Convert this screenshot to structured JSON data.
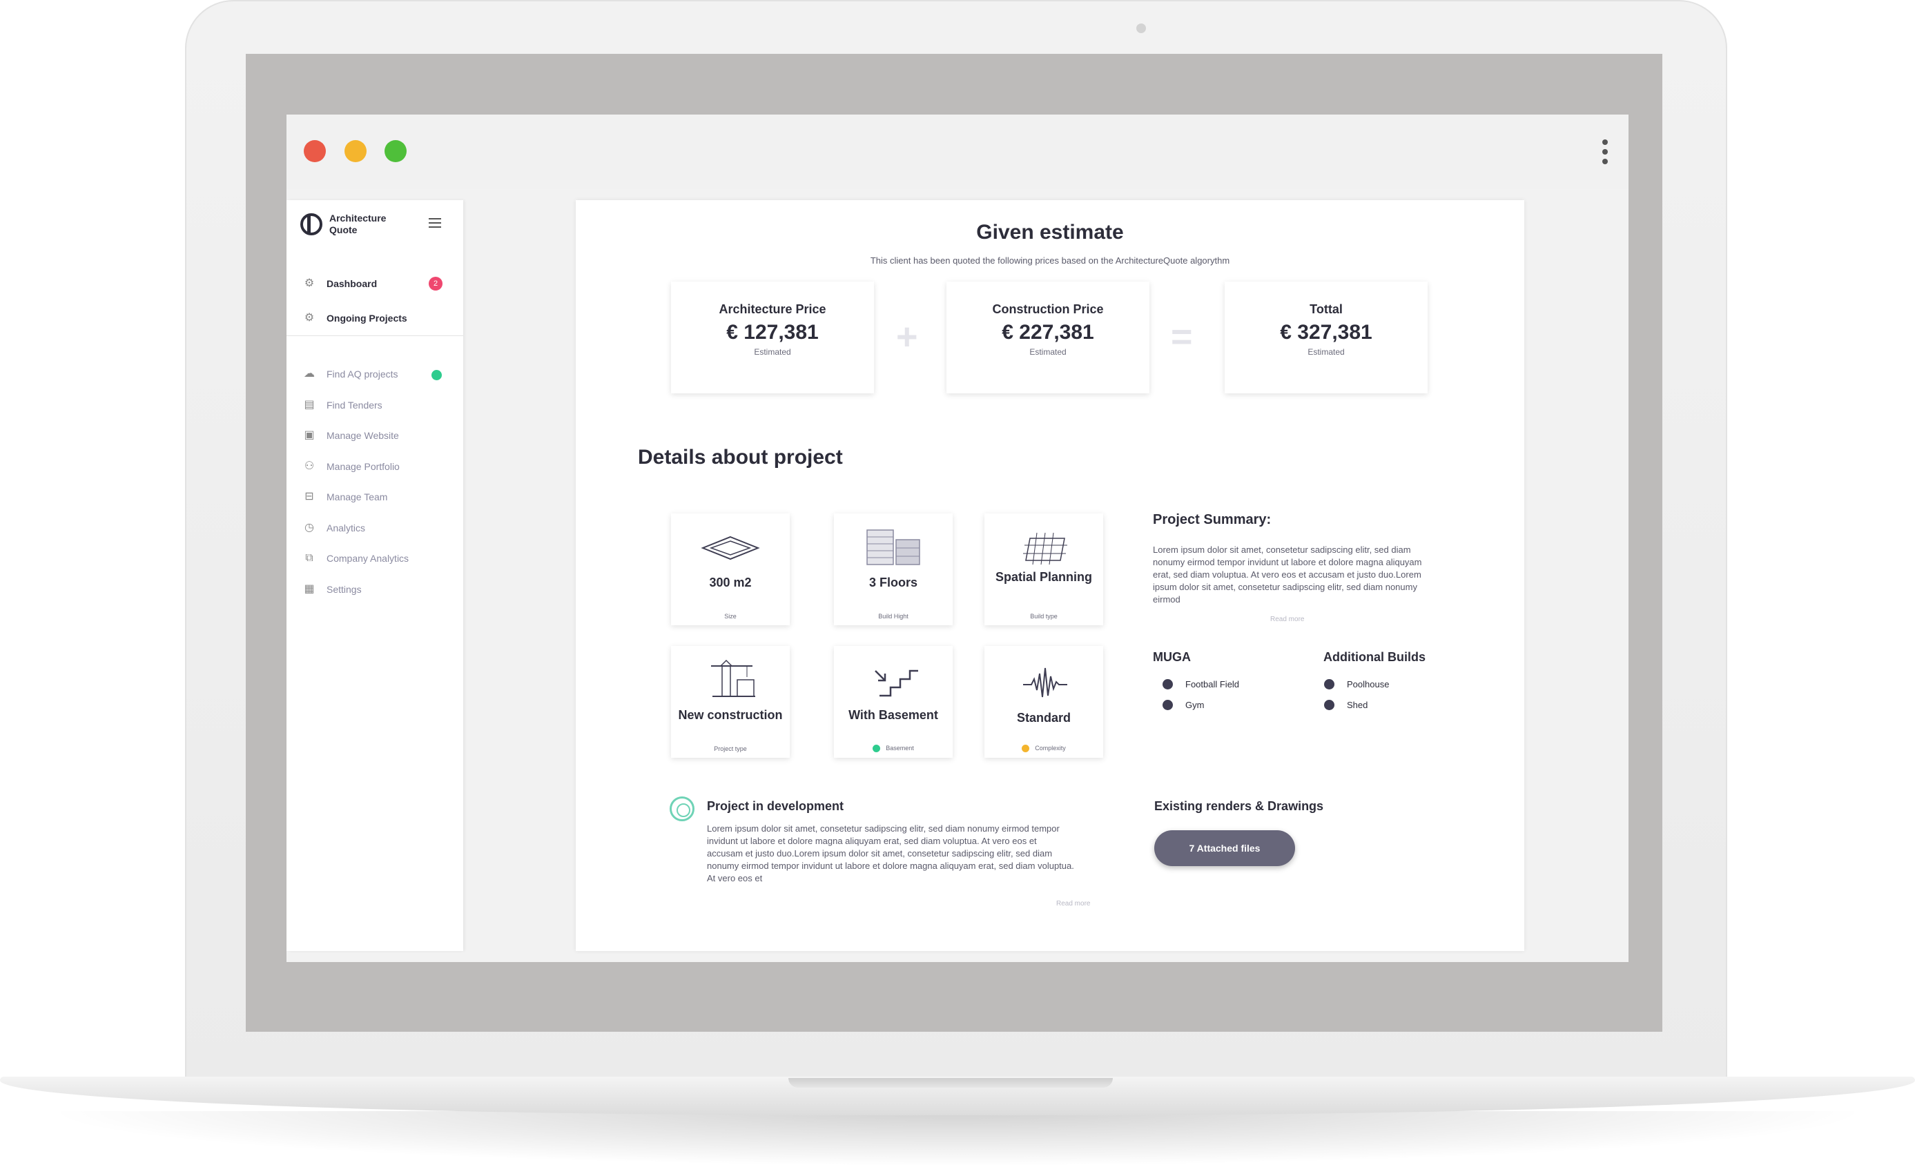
{
  "window": {
    "controls": [
      "close",
      "minimize",
      "maximize"
    ],
    "menu_icon": "kebab-menu-icon"
  },
  "sidebar": {
    "brand": "Architecture Quote",
    "primary_items": [
      {
        "label": "Dashboard",
        "icon": "gear-icon",
        "badge": "2"
      },
      {
        "label": "Ongoing Projects",
        "icon": "gear-icon"
      }
    ],
    "secondary_items": [
      {
        "label": "Find AQ projects",
        "icon": "cloud-upload-icon",
        "status": "online"
      },
      {
        "label": "Find Tenders",
        "icon": "message-icon"
      },
      {
        "label": "Manage Website",
        "icon": "image-icon"
      },
      {
        "label": "Manage Portfolio",
        "icon": "users-icon"
      },
      {
        "label": "Manage Team",
        "icon": "gamepad-icon"
      },
      {
        "label": "Analytics",
        "icon": "clock-icon"
      },
      {
        "label": "Company Analytics",
        "icon": "copy-icon"
      },
      {
        "label": "Settings",
        "icon": "calendar-icon"
      }
    ]
  },
  "estimate": {
    "title": "Given estimate",
    "subtitle": "This client has been quoted the following prices based on the ArchitectureQuote algorythm",
    "cards": [
      {
        "label": "Architecture Price",
        "value": "€ 127,381",
        "note": "Estimated"
      },
      {
        "label": "Construction Price",
        "value": "€ 227,381",
        "note": "Estimated"
      },
      {
        "label": "Tottal",
        "value": "€ 327,381",
        "note": "Estimated"
      }
    ],
    "operators": [
      "+",
      "="
    ]
  },
  "details": {
    "title": "Details about project",
    "tiles": [
      {
        "main": "300 m2",
        "sub": "Size",
        "icon": "floor-plane-icon"
      },
      {
        "main": "3 Floors",
        "sub": "Build Hight",
        "icon": "buildings-icon"
      },
      {
        "main": "Spatial Planning",
        "sub": "Build type",
        "icon": "grid-planning-icon"
      },
      {
        "main": "New construction",
        "sub": "Project type",
        "icon": "crane-icon"
      },
      {
        "main": "With Basement",
        "sub": "Basement",
        "icon": "stairs-down-icon",
        "dot_color": "#2ecc8e"
      },
      {
        "main": "Standard",
        "sub": "Complexity",
        "icon": "waveform-icon",
        "dot_color": "#f4b52e"
      }
    ]
  },
  "summary": {
    "title": "Project Summary:",
    "text": "Lorem ipsum dolor sit amet, consetetur sadipscing elitr, sed diam nonumy eirmod tempor invidunt ut labore et dolore magna aliquyam erat, sed diam voluptua. At vero eos et accusam et justo duo.Lorem ipsum dolor sit amet, consetetur sadipscing elitr, sed diam nonumy eirmod",
    "read_more": "Read more"
  },
  "muga": {
    "title": "MUGA",
    "items": [
      "Football Field",
      "Gym"
    ]
  },
  "additional": {
    "title": "Additional Builds",
    "items": [
      "Poolhouse",
      "Shed"
    ]
  },
  "development": {
    "title": "Project in development",
    "text": "Lorem ipsum dolor sit amet, consetetur sadipscing elitr, sed diam nonumy eirmod tempor invidunt ut labore et dolore magna aliquyam erat, sed diam voluptua. At vero eos et accusam et justo duo.Lorem ipsum dolor sit amet, consetetur sadipscing elitr, sed diam nonumy eirmod tempor invidunt ut labore et dolore magna aliquyam erat, sed diam voluptua. At vero eos et",
    "read_more": "Read more"
  },
  "renders": {
    "title": "Existing renders & Drawings",
    "button": "7 Attached files"
  }
}
